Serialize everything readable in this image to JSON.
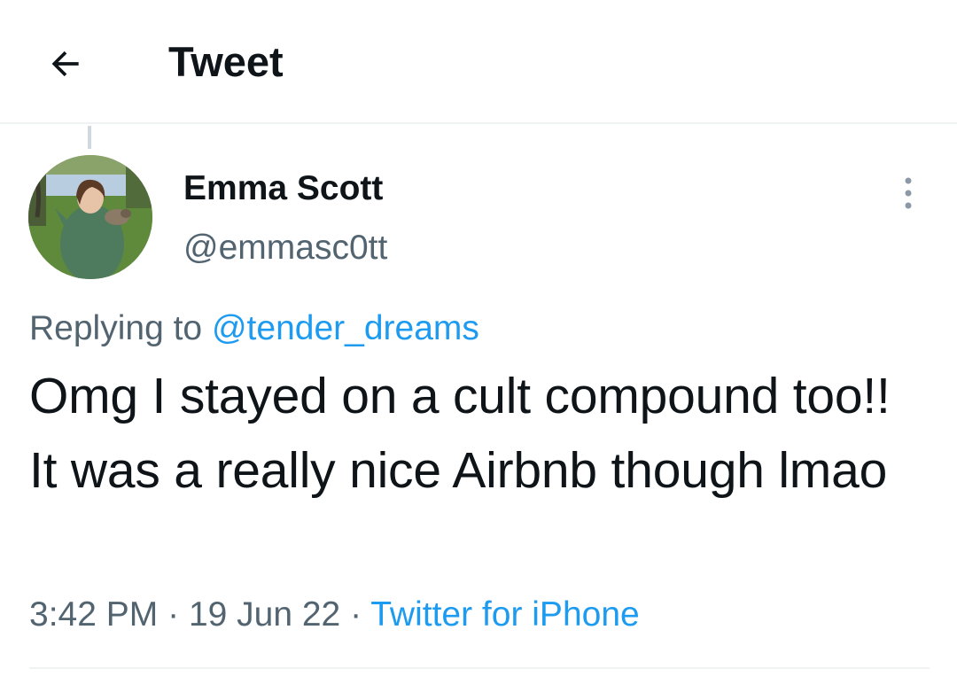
{
  "header": {
    "title": "Tweet",
    "back_icon": "arrow-left-icon"
  },
  "tweet": {
    "author": {
      "display_name": "Emma Scott",
      "handle": "@emmasc0tt",
      "avatar_icon": "profile-photo"
    },
    "more_icon": "vertical-ellipsis-icon",
    "replying_to_label": "Replying to",
    "replying_to_handle": "@tender_dreams",
    "text": "Omg I stayed on a cult compound too!! It was a really nice Airbnb though lmao",
    "time": "3:42 PM",
    "date": "19 Jun 22",
    "source": "Twitter for iPhone",
    "separator": "·"
  },
  "colors": {
    "text_primary": "#0f1419",
    "text_secondary": "#536471",
    "accent": "#1d9bf0",
    "divider": "#eff3f4"
  }
}
